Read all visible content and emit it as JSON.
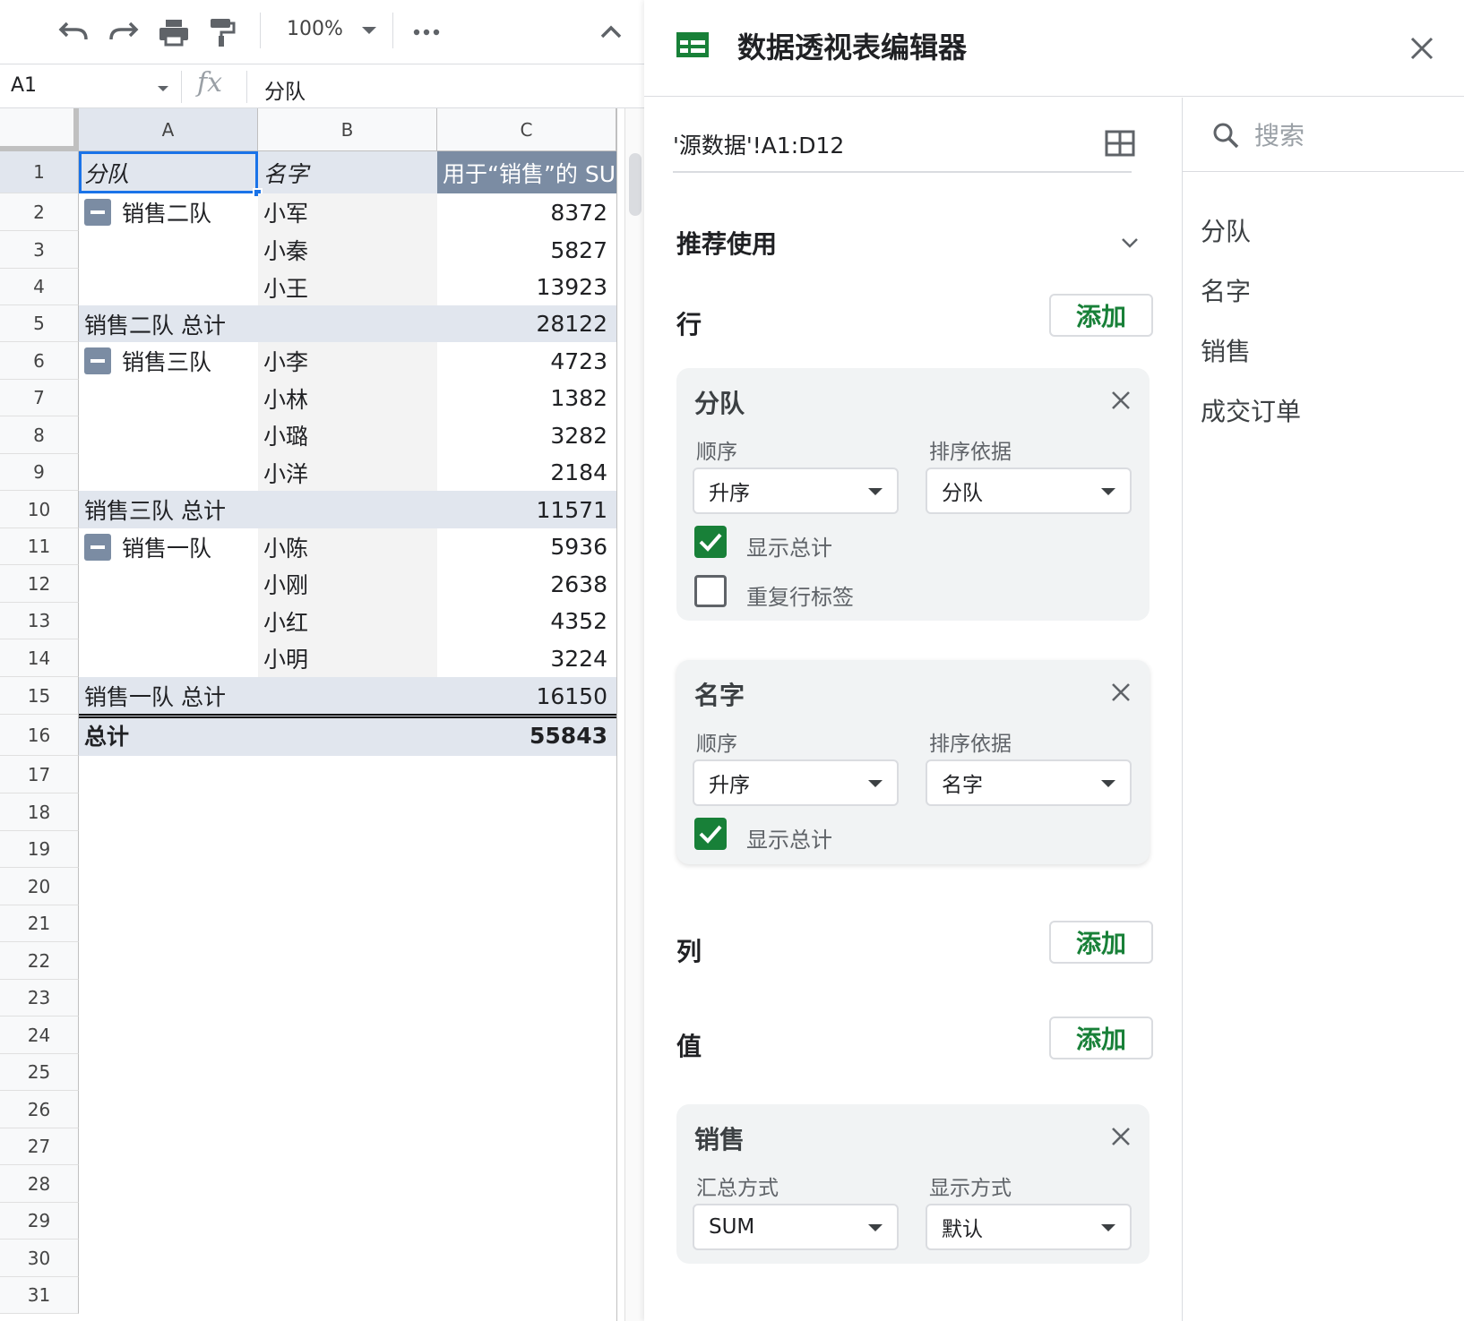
{
  "toolbar": {
    "zoom": "100%",
    "icons": [
      "undo-icon",
      "redo-icon",
      "print-icon",
      "paint-format-icon",
      "more-icon",
      "chevron-up-icon"
    ]
  },
  "formula_bar": {
    "cell_ref": "A1",
    "fx": "fx",
    "value": "分队"
  },
  "grid": {
    "columns": [
      "A",
      "B",
      "C"
    ],
    "row_numbers": [
      "1",
      "2",
      "3",
      "4",
      "5",
      "6",
      "7",
      "8",
      "9",
      "10",
      "11",
      "12",
      "13",
      "14",
      "15",
      "16",
      "17",
      "18",
      "19",
      "20",
      "21",
      "22",
      "23",
      "24",
      "25",
      "26",
      "27",
      "28",
      "29",
      "30",
      "31"
    ],
    "header_row": [
      "分队",
      "名字",
      "用于“销售”的 SU"
    ],
    "rows": [
      {
        "a": "销售二队",
        "b": "小军",
        "c": "8372",
        "collapse": true
      },
      {
        "a": "",
        "b": "小秦",
        "c": "5827"
      },
      {
        "a": "",
        "b": "小王",
        "c": "13923"
      },
      {
        "a": "销售二队 总计",
        "b": "",
        "c": "28122",
        "subtotal": true
      },
      {
        "a": "销售三队",
        "b": "小李",
        "c": "4723",
        "collapse": true
      },
      {
        "a": "",
        "b": "小林",
        "c": "1382"
      },
      {
        "a": "",
        "b": "小璐",
        "c": "3282"
      },
      {
        "a": "",
        "b": "小洋",
        "c": "2184"
      },
      {
        "a": "销售三队 总计",
        "b": "",
        "c": "11571",
        "subtotal": true
      },
      {
        "a": "销售一队",
        "b": "小陈",
        "c": "5936",
        "collapse": true
      },
      {
        "a": "",
        "b": "小刚",
        "c": "2638"
      },
      {
        "a": "",
        "b": "小红",
        "c": "4352"
      },
      {
        "a": "",
        "b": "小明",
        "c": "3224"
      },
      {
        "a": "销售一队 总计",
        "b": "",
        "c": "16150",
        "subtotal": true
      },
      {
        "a": "总计",
        "b": "",
        "c": "55843",
        "grandtotal": true
      }
    ]
  },
  "editor": {
    "title": "数据透视表编辑器",
    "range": "'源数据'!A1:D12",
    "recommend": "推荐使用",
    "rows_label": "行",
    "columns_label": "列",
    "values_label": "值",
    "add": "添加",
    "row_cards": [
      {
        "title": "分队",
        "order_label": "顺序",
        "order": "升序",
        "sortby_label": "排序依据",
        "sortby": "分队",
        "show_totals": "显示总计",
        "repeat_labels": "重复行标签"
      },
      {
        "title": "名字",
        "order_label": "顺序",
        "order": "升序",
        "sortby_label": "排序依据",
        "sortby": "名字",
        "show_totals": "显示总计"
      }
    ],
    "value_card": {
      "title": "销售",
      "summarize_label": "汇总方式",
      "summarize": "SUM",
      "show_as_label": "显示方式",
      "show_as": "默认"
    }
  },
  "field_list": {
    "search_placeholder": "搜索",
    "fields": [
      "分队",
      "名字",
      "销售",
      "成交订单"
    ]
  },
  "colors": {
    "green": "#188038",
    "header_blue": "#7b8ca3",
    "subtotal_bg": "#e1e6ee",
    "row_bg": "#f3f3f3",
    "selection": "#1a73e8"
  }
}
